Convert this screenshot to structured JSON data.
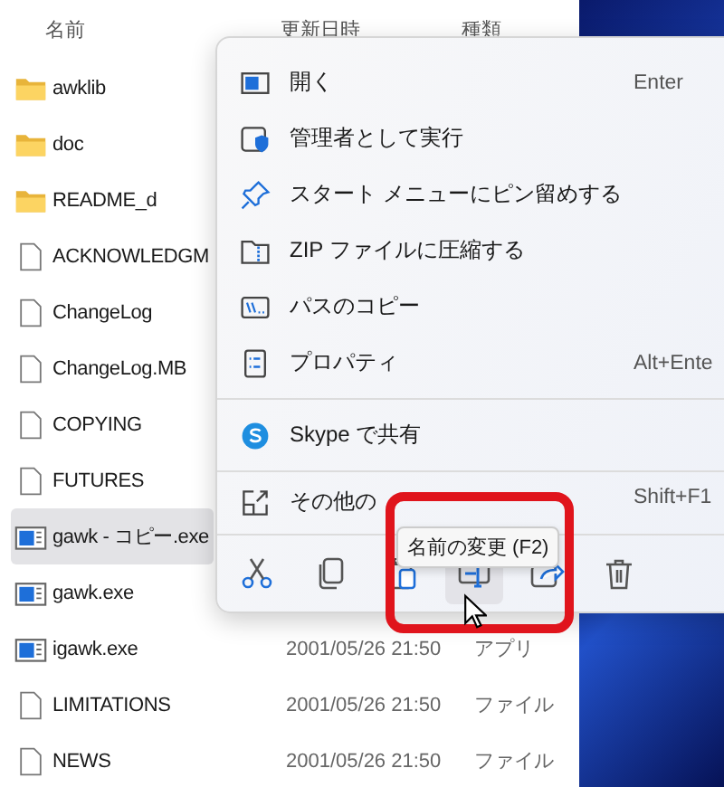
{
  "header": {
    "columns": [
      "名前",
      "更新日時",
      "種類"
    ]
  },
  "files": [
    {
      "name": "awklib",
      "kind": "folder",
      "selected": false
    },
    {
      "name": "doc",
      "kind": "folder",
      "selected": false
    },
    {
      "name": "README_d",
      "kind": "folder",
      "selected": false
    },
    {
      "name": "ACKNOWLEDGM",
      "kind": "file",
      "selected": false
    },
    {
      "name": "ChangeLog",
      "kind": "file",
      "selected": false
    },
    {
      "name": "ChangeLog.MB",
      "kind": "file",
      "selected": false
    },
    {
      "name": "COPYING",
      "kind": "file",
      "selected": false
    },
    {
      "name": "FUTURES",
      "kind": "file",
      "selected": false
    },
    {
      "name": "gawk - コピー.exe",
      "kind": "exe",
      "selected": true
    },
    {
      "name": "gawk.exe",
      "kind": "exe",
      "selected": false
    },
    {
      "name": "igawk.exe",
      "kind": "exe",
      "selected": false,
      "date": "2001/05/26 21:50",
      "type": "アプリ"
    },
    {
      "name": "LIMITATIONS",
      "kind": "file",
      "selected": false,
      "date": "2001/05/26 21:50",
      "type": "ファイル"
    },
    {
      "name": "NEWS",
      "kind": "file",
      "selected": false,
      "date": "2001/05/26 21:50",
      "type": "ファイル"
    }
  ],
  "menu": {
    "groups": [
      [
        {
          "label": "開く",
          "shortcut": "Enter"
        },
        {
          "label": "管理者として実行"
        },
        {
          "label": "スタート メニューにピン留めする"
        },
        {
          "label": "ZIP ファイルに圧縮する"
        },
        {
          "label": "パスのコピー"
        },
        {
          "label": "プロパティ",
          "shortcut": "Alt+Ente"
        }
      ],
      [
        {
          "label": "Skype で共有"
        }
      ],
      [
        {
          "label": "その他の",
          "shortcut": "Shift+F1"
        }
      ]
    ],
    "toolbar": [
      {
        "hovered": false
      },
      {
        "hovered": false
      },
      {
        "hovered": false
      },
      {
        "hovered": true
      },
      {
        "hovered": false
      },
      {
        "hovered": false
      }
    ],
    "tooltip": "名前の変更 (F2)"
  }
}
